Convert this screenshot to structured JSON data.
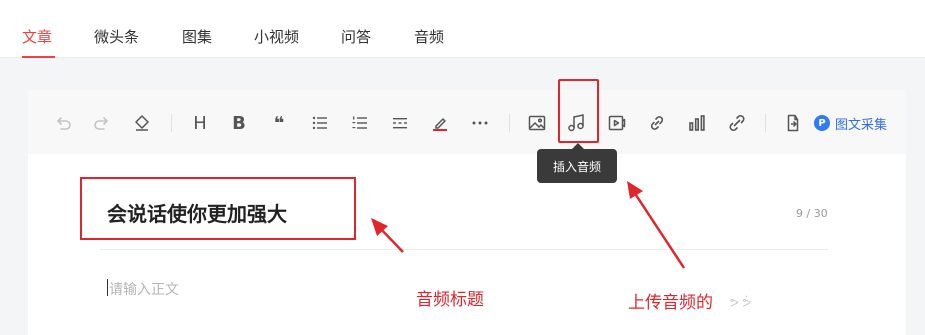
{
  "tabs": [
    {
      "label": "文章",
      "active": true
    },
    {
      "label": "微头条",
      "active": false
    },
    {
      "label": "图集",
      "active": false
    },
    {
      "label": "小视频",
      "active": false
    },
    {
      "label": "问答",
      "active": false
    },
    {
      "label": "音频",
      "active": false
    }
  ],
  "toolbar": {
    "heading_label": "H",
    "bold_label": "B",
    "quote_label": "❝",
    "collect_badge": "P",
    "collect_label": "图文采集",
    "audio_tooltip": "插入音频"
  },
  "article": {
    "title": "会说话使你更加强大",
    "char_count": "9 / 30",
    "body_placeholder": "请输入正文"
  },
  "annotations": {
    "title_note": "音频标题",
    "upload_note": "上传音频的"
  },
  "watermark": "ᕗ ᕘ",
  "colors": {
    "accent": "#f04142",
    "annotation_red": "#e0262c",
    "link_blue": "#2f6fe8"
  }
}
